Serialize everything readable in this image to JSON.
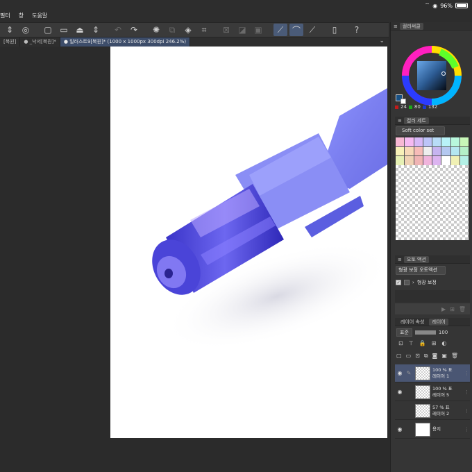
{
  "status": {
    "battery": "96%"
  },
  "menu": {
    "items": [
      "필터",
      "창",
      "도움말"
    ]
  },
  "tabs": [
    {
      "label": "[복원]",
      "active": false
    },
    {
      "label": "● _낙서[복원]*",
      "active": false
    },
    {
      "label": "● 일러스트9[복원]* (1000 x 1000px 300dpi 246.2%)",
      "active": true
    }
  ],
  "panels": {
    "color_tab": "컬러써클",
    "color_values": {
      "r": "24",
      "g": "80",
      "b": "132"
    },
    "color_set_tab": "컬러 세트",
    "color_set_select": "Soft color set",
    "palette": [
      "#f7b8d4",
      "#f5b9f2",
      "#d6b8f7",
      "#bcc4f8",
      "#b8dcf7",
      "#b8f3f7",
      "#b8f7dc",
      "#c8f7b8",
      "#f7f1b8",
      "#f7d9b8",
      "#f7bcb8",
      "#eeeeee",
      "#c6b4f0",
      "#b4c8f0",
      "#b4e6f0",
      "#b4f0c8",
      "#e6f0b4",
      "#f0d2b4",
      "#f0b4b4",
      "#f0b4dc",
      "#dcb4f0",
      "#ffffff",
      "#f0f0b4",
      "#b4f0e6"
    ],
    "auto_action_tab": "오토 액션",
    "auto_action_select": "형광 보정 오토액션",
    "auto_action_item": "형광 보정",
    "layer_prop_tab": "레이어 속성",
    "layer_tab": "레이어",
    "blend_mode": "표준",
    "opacity": "100"
  },
  "layers": [
    {
      "opacity": "100 %",
      "mode": "표",
      "name": "레이어 1",
      "selected": true,
      "visible": true
    },
    {
      "opacity": "100 %",
      "mode": "표",
      "name": "레이어 5",
      "selected": false,
      "visible": true
    },
    {
      "opacity": "57 %",
      "mode": "표",
      "name": "레이어 2",
      "selected": false,
      "visible": false
    },
    {
      "opacity": "",
      "mode": "",
      "name": "용지",
      "selected": false,
      "visible": true
    }
  ]
}
